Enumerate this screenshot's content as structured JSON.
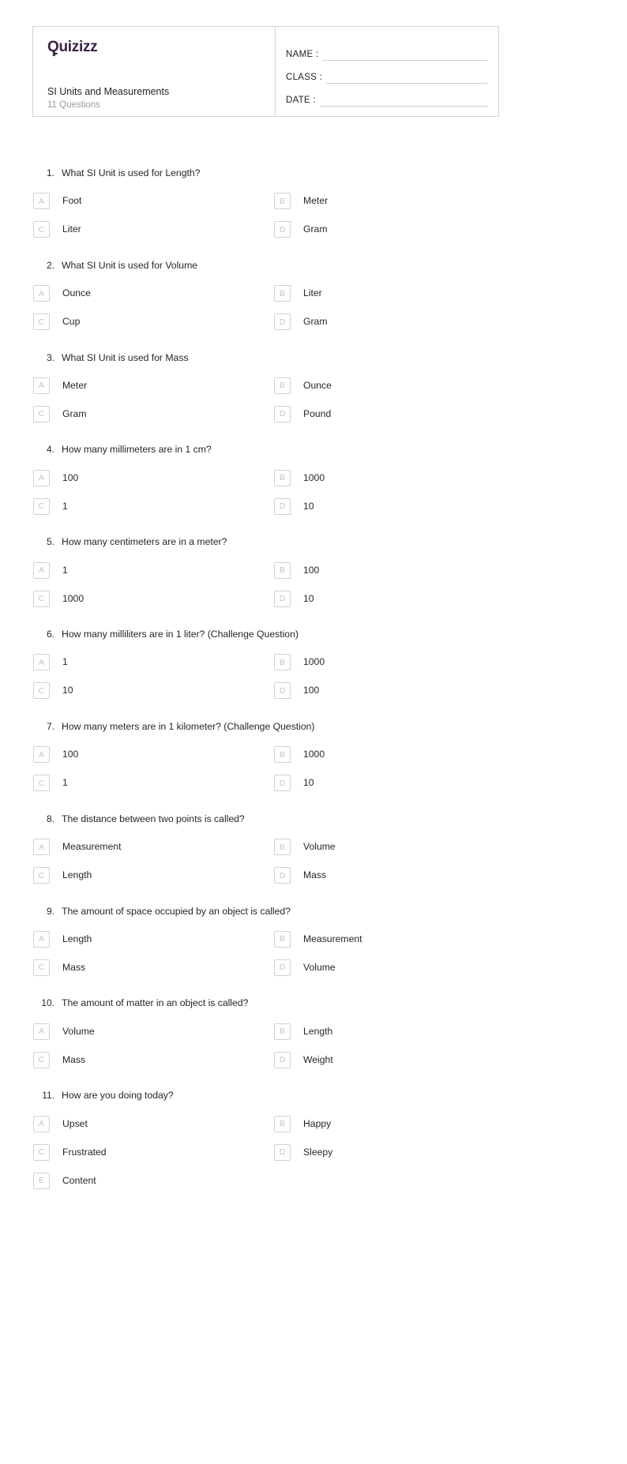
{
  "brand": {
    "logo_text": "Quizizz",
    "logo_color": "#3b2147"
  },
  "header": {
    "quiz_title": "SI Units and Measurements",
    "question_count_label": "11 Questions",
    "fields": [
      {
        "label": "NAME :"
      },
      {
        "label": "CLASS :"
      },
      {
        "label": "DATE  :"
      }
    ]
  },
  "questions": [
    {
      "number": "1.",
      "text": "What SI Unit is used for Length?",
      "options": [
        {
          "letter": "A",
          "text": "Foot"
        },
        {
          "letter": "B",
          "text": "Meter"
        },
        {
          "letter": "C",
          "text": "Liter"
        },
        {
          "letter": "D",
          "text": "Gram"
        }
      ]
    },
    {
      "number": "2.",
      "text": "What SI Unit is used for Volume",
      "options": [
        {
          "letter": "A",
          "text": "Ounce"
        },
        {
          "letter": "B",
          "text": "Liter"
        },
        {
          "letter": "C",
          "text": "Cup"
        },
        {
          "letter": "D",
          "text": "Gram"
        }
      ]
    },
    {
      "number": "3.",
      "text": "What SI Unit is used for Mass",
      "options": [
        {
          "letter": "A",
          "text": "Meter"
        },
        {
          "letter": "B",
          "text": "Ounce"
        },
        {
          "letter": "C",
          "text": "Gram"
        },
        {
          "letter": "D",
          "text": "Pound"
        }
      ]
    },
    {
      "number": "4.",
      "text": "How many millimeters are in 1 cm?",
      "options": [
        {
          "letter": "A",
          "text": "100"
        },
        {
          "letter": "B",
          "text": "1000"
        },
        {
          "letter": "C",
          "text": "1"
        },
        {
          "letter": "D",
          "text": "10"
        }
      ]
    },
    {
      "number": "5.",
      "text": "How many centimeters are in a meter?",
      "options": [
        {
          "letter": "A",
          "text": "1"
        },
        {
          "letter": "B",
          "text": "100"
        },
        {
          "letter": "C",
          "text": "1000"
        },
        {
          "letter": "D",
          "text": "10"
        }
      ]
    },
    {
      "number": "6.",
      "text": "How many milliliters are in 1 liter? (Challenge Question)",
      "options": [
        {
          "letter": "A",
          "text": "1"
        },
        {
          "letter": "B",
          "text": "1000"
        },
        {
          "letter": "C",
          "text": "10"
        },
        {
          "letter": "D",
          "text": "100"
        }
      ]
    },
    {
      "number": "7.",
      "text": "How many meters are in 1 kilometer? (Challenge Question)",
      "options": [
        {
          "letter": "A",
          "text": "100"
        },
        {
          "letter": "B",
          "text": "1000"
        },
        {
          "letter": "C",
          "text": "1"
        },
        {
          "letter": "D",
          "text": "10"
        }
      ]
    },
    {
      "number": "8.",
      "text": "The distance between two points is called?",
      "options": [
        {
          "letter": "A",
          "text": "Measurement"
        },
        {
          "letter": "B",
          "text": "Volume"
        },
        {
          "letter": "C",
          "text": "Length"
        },
        {
          "letter": "D",
          "text": "Mass"
        }
      ]
    },
    {
      "number": "9.",
      "text": "The amount of space occupied by an object is called?",
      "options": [
        {
          "letter": "A",
          "text": "Length"
        },
        {
          "letter": "B",
          "text": "Measurement"
        },
        {
          "letter": "C",
          "text": "Mass"
        },
        {
          "letter": "D",
          "text": "Volume"
        }
      ]
    },
    {
      "number": "10.",
      "text": "The amount of matter in an object is called?",
      "options": [
        {
          "letter": "A",
          "text": "Volume"
        },
        {
          "letter": "B",
          "text": "Length"
        },
        {
          "letter": "C",
          "text": "Mass"
        },
        {
          "letter": "D",
          "text": "Weight"
        }
      ]
    },
    {
      "number": "11.",
      "text": "How are you doing today?",
      "options": [
        {
          "letter": "A",
          "text": "Upset"
        },
        {
          "letter": "B",
          "text": "Happy"
        },
        {
          "letter": "C",
          "text": "Frustrated"
        },
        {
          "letter": "D",
          "text": "Sleepy"
        },
        {
          "letter": "E",
          "text": "Content"
        }
      ]
    }
  ]
}
